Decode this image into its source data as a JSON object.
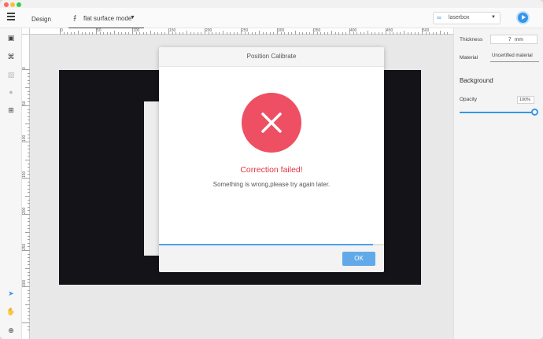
{
  "topbar": {
    "design_tab": "Design",
    "mode_label": "flat surface mode",
    "device_label": "laserbox"
  },
  "ruler": {
    "x_labels": [
      "0",
      "50",
      "100",
      "150",
      "200",
      "250",
      "300",
      "350",
      "400",
      "450",
      "500"
    ],
    "y_labels": [
      "0",
      "50",
      "100",
      "150",
      "200",
      "250",
      "300"
    ]
  },
  "panel": {
    "thickness_label": "Thickness",
    "thickness_value": "7",
    "thickness_unit": "mm",
    "material_label": "Material",
    "material_value": "Uncertified material",
    "background_heading": "Background",
    "opacity_label": "Opacity",
    "opacity_value": "100%",
    "opacity_level": 1.0
  },
  "dialog": {
    "title": "Position Calibrate",
    "error_title": "Correction failed!",
    "error_message": "Something is wrong,please try again later.",
    "progress": 0.95,
    "ok_label": "OK"
  },
  "colors": {
    "accent": "#2b8fe8",
    "error": "#ee4f62",
    "error_text": "#e03444"
  },
  "icons": [
    "menu-icon",
    "flat-surface-icon",
    "chevron-down-icon",
    "link-icon",
    "play-icon",
    "folder-icon",
    "crop-icon",
    "image-icon",
    "person-icon",
    "add-shape-icon",
    "cursor-icon",
    "hand-icon",
    "zoom-icon",
    "close-icon"
  ]
}
